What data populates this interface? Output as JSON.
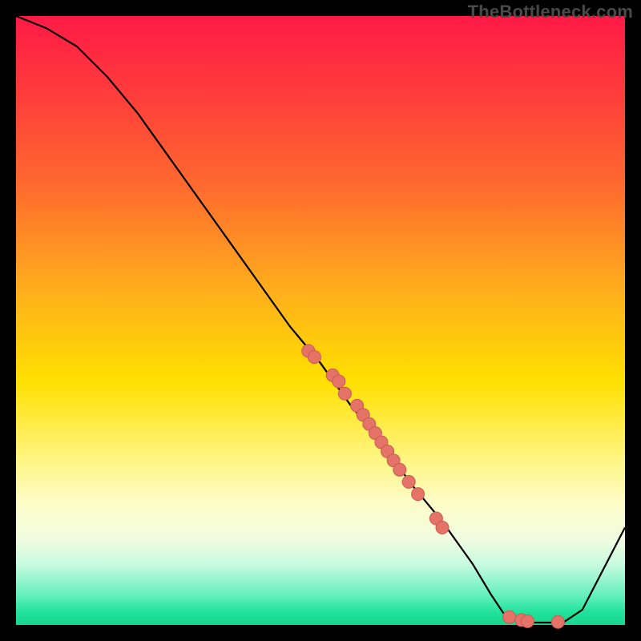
{
  "watermark": "TheBottleneck.com",
  "colors": {
    "dot_fill": "#e57368",
    "dot_stroke": "#c95a52",
    "curve": "#000000"
  },
  "chart_data": {
    "type": "line",
    "title": "",
    "xlabel": "",
    "ylabel": "",
    "xlim": [
      0,
      100
    ],
    "ylim": [
      0,
      100
    ],
    "grid": false,
    "series": [
      {
        "name": "bottleneck-curve",
        "x": [
          0,
          5,
          10,
          15,
          20,
          25,
          30,
          35,
          40,
          45,
          50,
          55,
          60,
          65,
          70,
          75,
          78,
          80,
          82,
          85,
          88,
          90,
          93,
          100
        ],
        "y": [
          100,
          98,
          95,
          90,
          84,
          77,
          70,
          63,
          56,
          49,
          43,
          36,
          30,
          23,
          17,
          10,
          5,
          2,
          0.7,
          0.4,
          0.4,
          0.5,
          2.5,
          16
        ]
      }
    ],
    "scatter": {
      "name": "highlighted-points",
      "points": [
        {
          "x": 48,
          "y": 45
        },
        {
          "x": 49,
          "y": 44
        },
        {
          "x": 52,
          "y": 41
        },
        {
          "x": 53,
          "y": 40
        },
        {
          "x": 54,
          "y": 38
        },
        {
          "x": 56,
          "y": 36
        },
        {
          "x": 57,
          "y": 34.5
        },
        {
          "x": 58,
          "y": 33
        },
        {
          "x": 59,
          "y": 31.5
        },
        {
          "x": 60,
          "y": 30
        },
        {
          "x": 61,
          "y": 28.5
        },
        {
          "x": 62,
          "y": 27
        },
        {
          "x": 63,
          "y": 25.5
        },
        {
          "x": 64.5,
          "y": 23.5
        },
        {
          "x": 66,
          "y": 21.5
        },
        {
          "x": 69,
          "y": 17.5
        },
        {
          "x": 70,
          "y": 16
        },
        {
          "x": 81,
          "y": 1.3
        },
        {
          "x": 83,
          "y": 0.8
        },
        {
          "x": 84,
          "y": 0.6
        },
        {
          "x": 89,
          "y": 0.5
        }
      ]
    }
  }
}
